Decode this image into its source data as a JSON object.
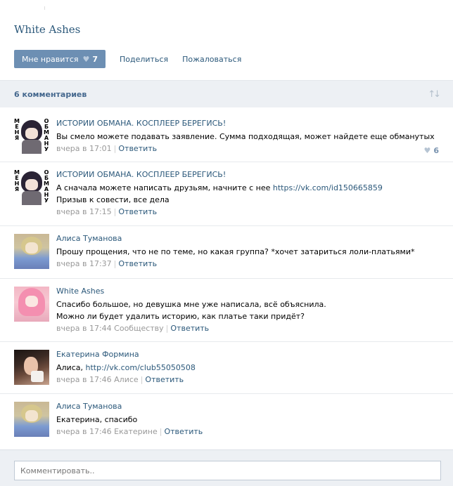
{
  "post": {
    "title": "White Ashes",
    "like_label": "Мне нравится",
    "like_count": "7",
    "share_label": "Поделиться",
    "report_label": "Пожаловаться"
  },
  "comments_header": {
    "count_label": "6 комментариев",
    "sort_icon": "sort-arrows-icon"
  },
  "avatar_text": {
    "left": [
      "М",
      "Е",
      "Н",
      "Я"
    ],
    "right": [
      "О",
      "Б",
      "М",
      "А",
      "Н",
      "У"
    ]
  },
  "comments": [
    {
      "author": "ИСТОРИИ ОБМАНА. КОСПЛЕЕР БЕРЕГИСЬ!",
      "text": "Вы смело можете подавать заявление. Сумма подходящая, может найдете еще обманутых",
      "time": "вчера в 17:01",
      "reply_label": "Ответить",
      "likes": "6"
    },
    {
      "author": "ИСТОРИИ ОБМАНА. КОСПЛЕЕР БЕРЕГИСЬ!",
      "text_before": "А сначала можете написать друзьям, начните с нее ",
      "link": "https://vk.com/id150665859",
      "text_after": " Призыв к совести, все дела",
      "time": "вчера в 17:15",
      "reply_label": "Ответить"
    },
    {
      "author": "Алиса Туманова",
      "text": "Прошу прощения, что не по теме, но какая группа? *хочет затариться лоли-платьями*",
      "time": "вчера в 17:37",
      "reply_label": "Ответить"
    },
    {
      "author": "White Ashes",
      "text_line1": "Спасибо большое, но девушка мне уже написала, всё объяснила.",
      "text_line2": "Можно ли будет удалить историю, как платье таки придёт?",
      "time": "вчера в 17:44",
      "to": "Сообществу",
      "reply_label": "Ответить"
    },
    {
      "author": "Екатерина Формина",
      "text_before": "Алиса, ",
      "link": "http://vk.com/club55050508",
      "time": "вчера в 17:46",
      "to": "Алисе",
      "reply_label": "Ответить"
    },
    {
      "author": "Алиса Туманова",
      "text": "Екатерина, спасибо",
      "time": "вчера в 17:46",
      "to": "Екатерине",
      "reply_label": "Ответить"
    }
  ],
  "composer": {
    "placeholder": "Комментировать.."
  }
}
